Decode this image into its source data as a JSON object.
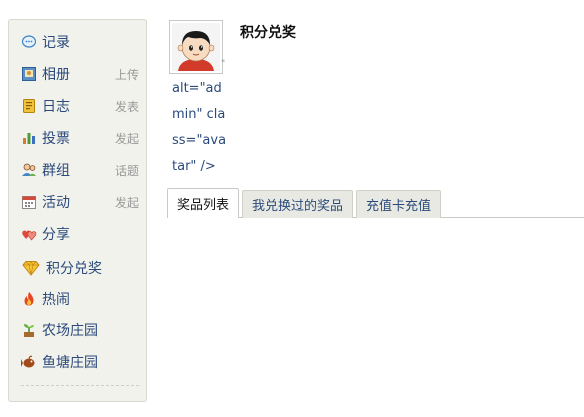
{
  "sidebar": {
    "items": [
      {
        "label": "记录",
        "action": "",
        "icon": "speech-bubble-icon"
      },
      {
        "label": "相册",
        "action": "上传",
        "icon": "photo-album-icon"
      },
      {
        "label": "日志",
        "action": "发表",
        "icon": "notebook-icon"
      },
      {
        "label": "投票",
        "action": "发起",
        "icon": "bar-chart-icon"
      },
      {
        "label": "群组",
        "action": "话题",
        "icon": "group-icon"
      },
      {
        "label": "活动",
        "action": "发起",
        "icon": "calendar-icon"
      },
      {
        "label": "分享",
        "action": "",
        "icon": "hearts-icon"
      },
      {
        "label": "积分兑奖",
        "action": "",
        "icon": "gem-icon"
      },
      {
        "label": "热闹",
        "action": "",
        "icon": "flame-icon"
      },
      {
        "label": "农场庄园",
        "action": "",
        "icon": "sprout-icon"
      },
      {
        "label": "鱼塘庄园",
        "action": "",
        "icon": "fish-icon"
      }
    ]
  },
  "header": {
    "title": "积分兑奖",
    "avatar_alt_leak": [
      "alt=\"ad",
      "min\" cla",
      "ss=\"ava",
      "tar\" />"
    ],
    "avatar_tick": "\""
  },
  "tabs": [
    {
      "label": "奖品列表",
      "active": true
    },
    {
      "label": "我兑换过的奖品",
      "active": false
    },
    {
      "label": "充值卡充值",
      "active": false
    }
  ],
  "colors": {
    "link": "#2b4a7a",
    "sidebar_bg": "#f2f2ed",
    "action": "#999999"
  }
}
